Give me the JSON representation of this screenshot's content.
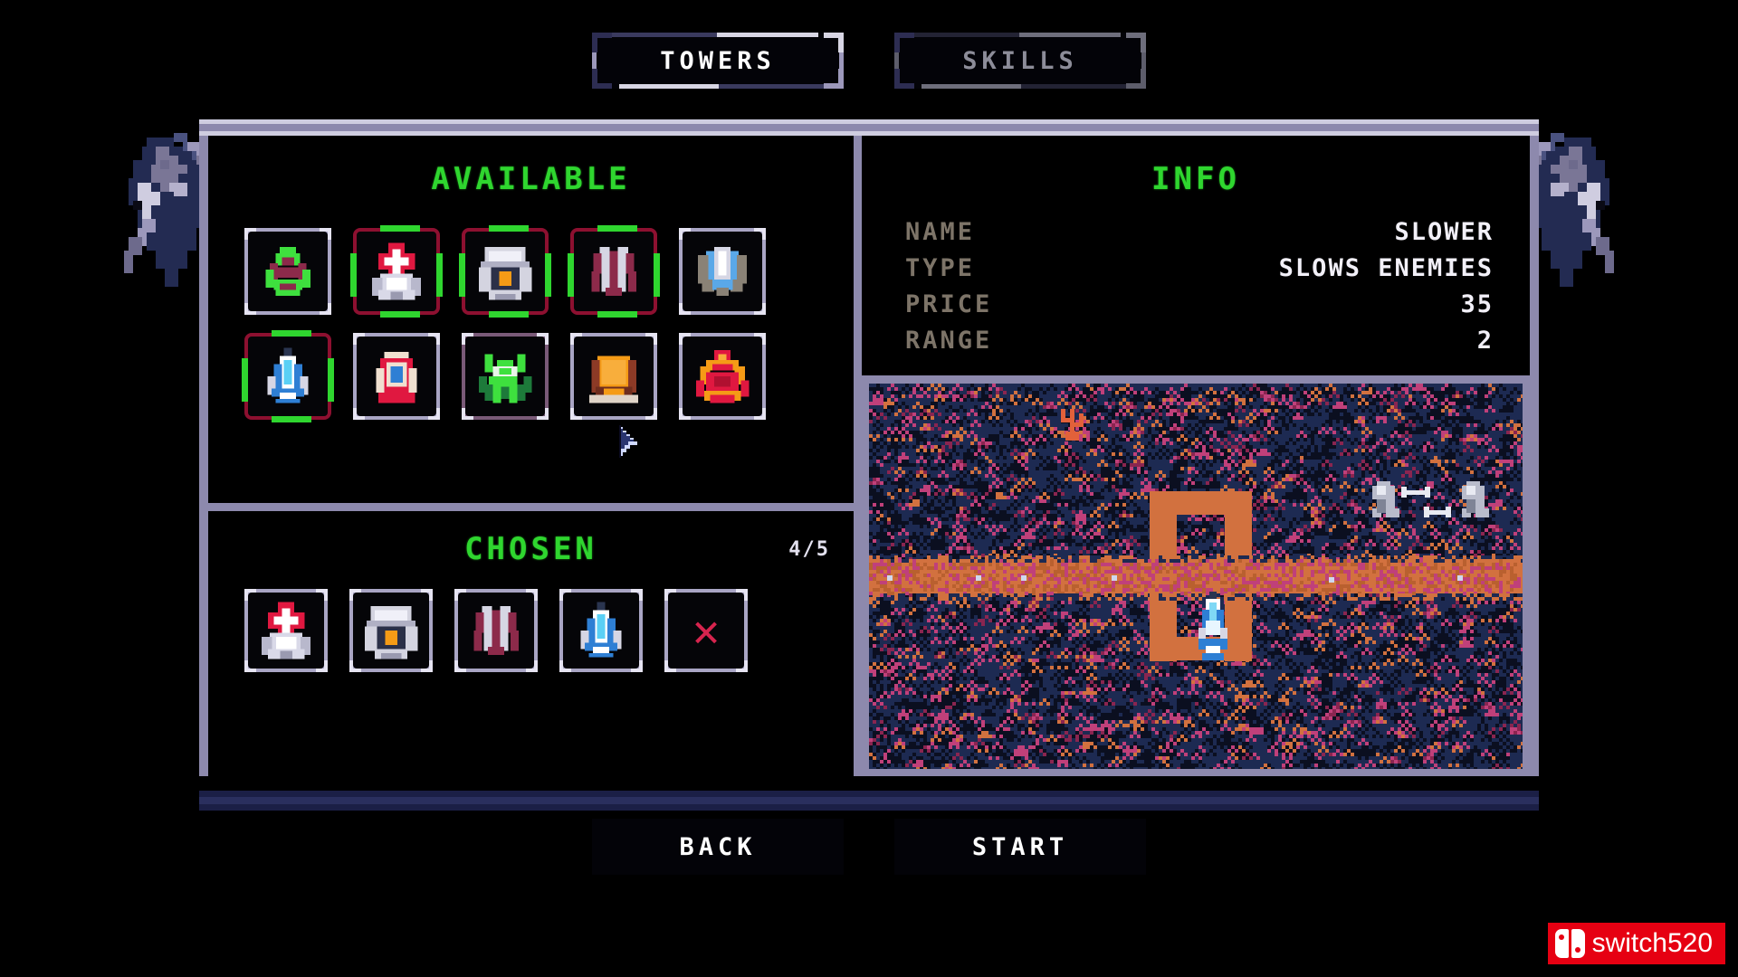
{
  "tabs": [
    {
      "label": "TOWERS",
      "active": true,
      "name": "tab-towers"
    },
    {
      "label": "SKILLS",
      "active": false,
      "name": "tab-skills"
    }
  ],
  "available": {
    "title": "AVAILABLE",
    "towers": [
      {
        "name": "green-frog-tower",
        "selected": false,
        "style": "plain"
      },
      {
        "name": "medic-tower",
        "selected": true,
        "style": "sel"
      },
      {
        "name": "heavy-tower",
        "selected": true,
        "style": "sel"
      },
      {
        "name": "crimson-claw-tower",
        "selected": true,
        "style": "sel"
      },
      {
        "name": "shield-tower",
        "selected": false,
        "style": "plain"
      },
      {
        "name": "slower-tower",
        "selected": true,
        "style": "sel"
      },
      {
        "name": "red-capsule-tower",
        "selected": false,
        "style": "plain"
      },
      {
        "name": "green-mantis-tower",
        "selected": false,
        "style": "purpleish"
      },
      {
        "name": "orange-bunker-tower",
        "selected": false,
        "style": "plain"
      },
      {
        "name": "red-crab-tower",
        "selected": false,
        "style": "plain"
      }
    ]
  },
  "chosen": {
    "title": "CHOSEN",
    "count": "4/5",
    "slots": [
      {
        "name": "medic-tower",
        "kind": "tower"
      },
      {
        "name": "heavy-tower",
        "kind": "tower"
      },
      {
        "name": "crimson-claw-tower",
        "kind": "tower"
      },
      {
        "name": "slower-tower",
        "kind": "tower"
      },
      {
        "name": "empty-slot",
        "kind": "empty",
        "glyph": "✕"
      }
    ]
  },
  "info": {
    "title": "INFO",
    "rows": [
      {
        "label": "NAME",
        "value": "SLOWER"
      },
      {
        "label": "TYPE",
        "value": "SLOWS ENEMIES"
      },
      {
        "label": "PRICE",
        "value": "35"
      },
      {
        "label": "RANGE",
        "value": "2"
      }
    ]
  },
  "map": {
    "name": "map-preview",
    "terrain_color": "#1d2a52",
    "path_color": "#d2713f",
    "accent_color": "#c0407a"
  },
  "buttons": [
    {
      "label": "BACK",
      "name": "back-button"
    },
    {
      "label": "START",
      "name": "start-button"
    }
  ],
  "watermark": {
    "text": "switch520",
    "brand_color": "#e60012"
  },
  "palette": {
    "heading_green": "#2fd62f",
    "frame_lavender": "#8d89ad",
    "frame_light": "#cfcde0",
    "label_gray": "#7d7468",
    "selected_red": "#8d1030",
    "accent_green": "#2fd62f"
  }
}
